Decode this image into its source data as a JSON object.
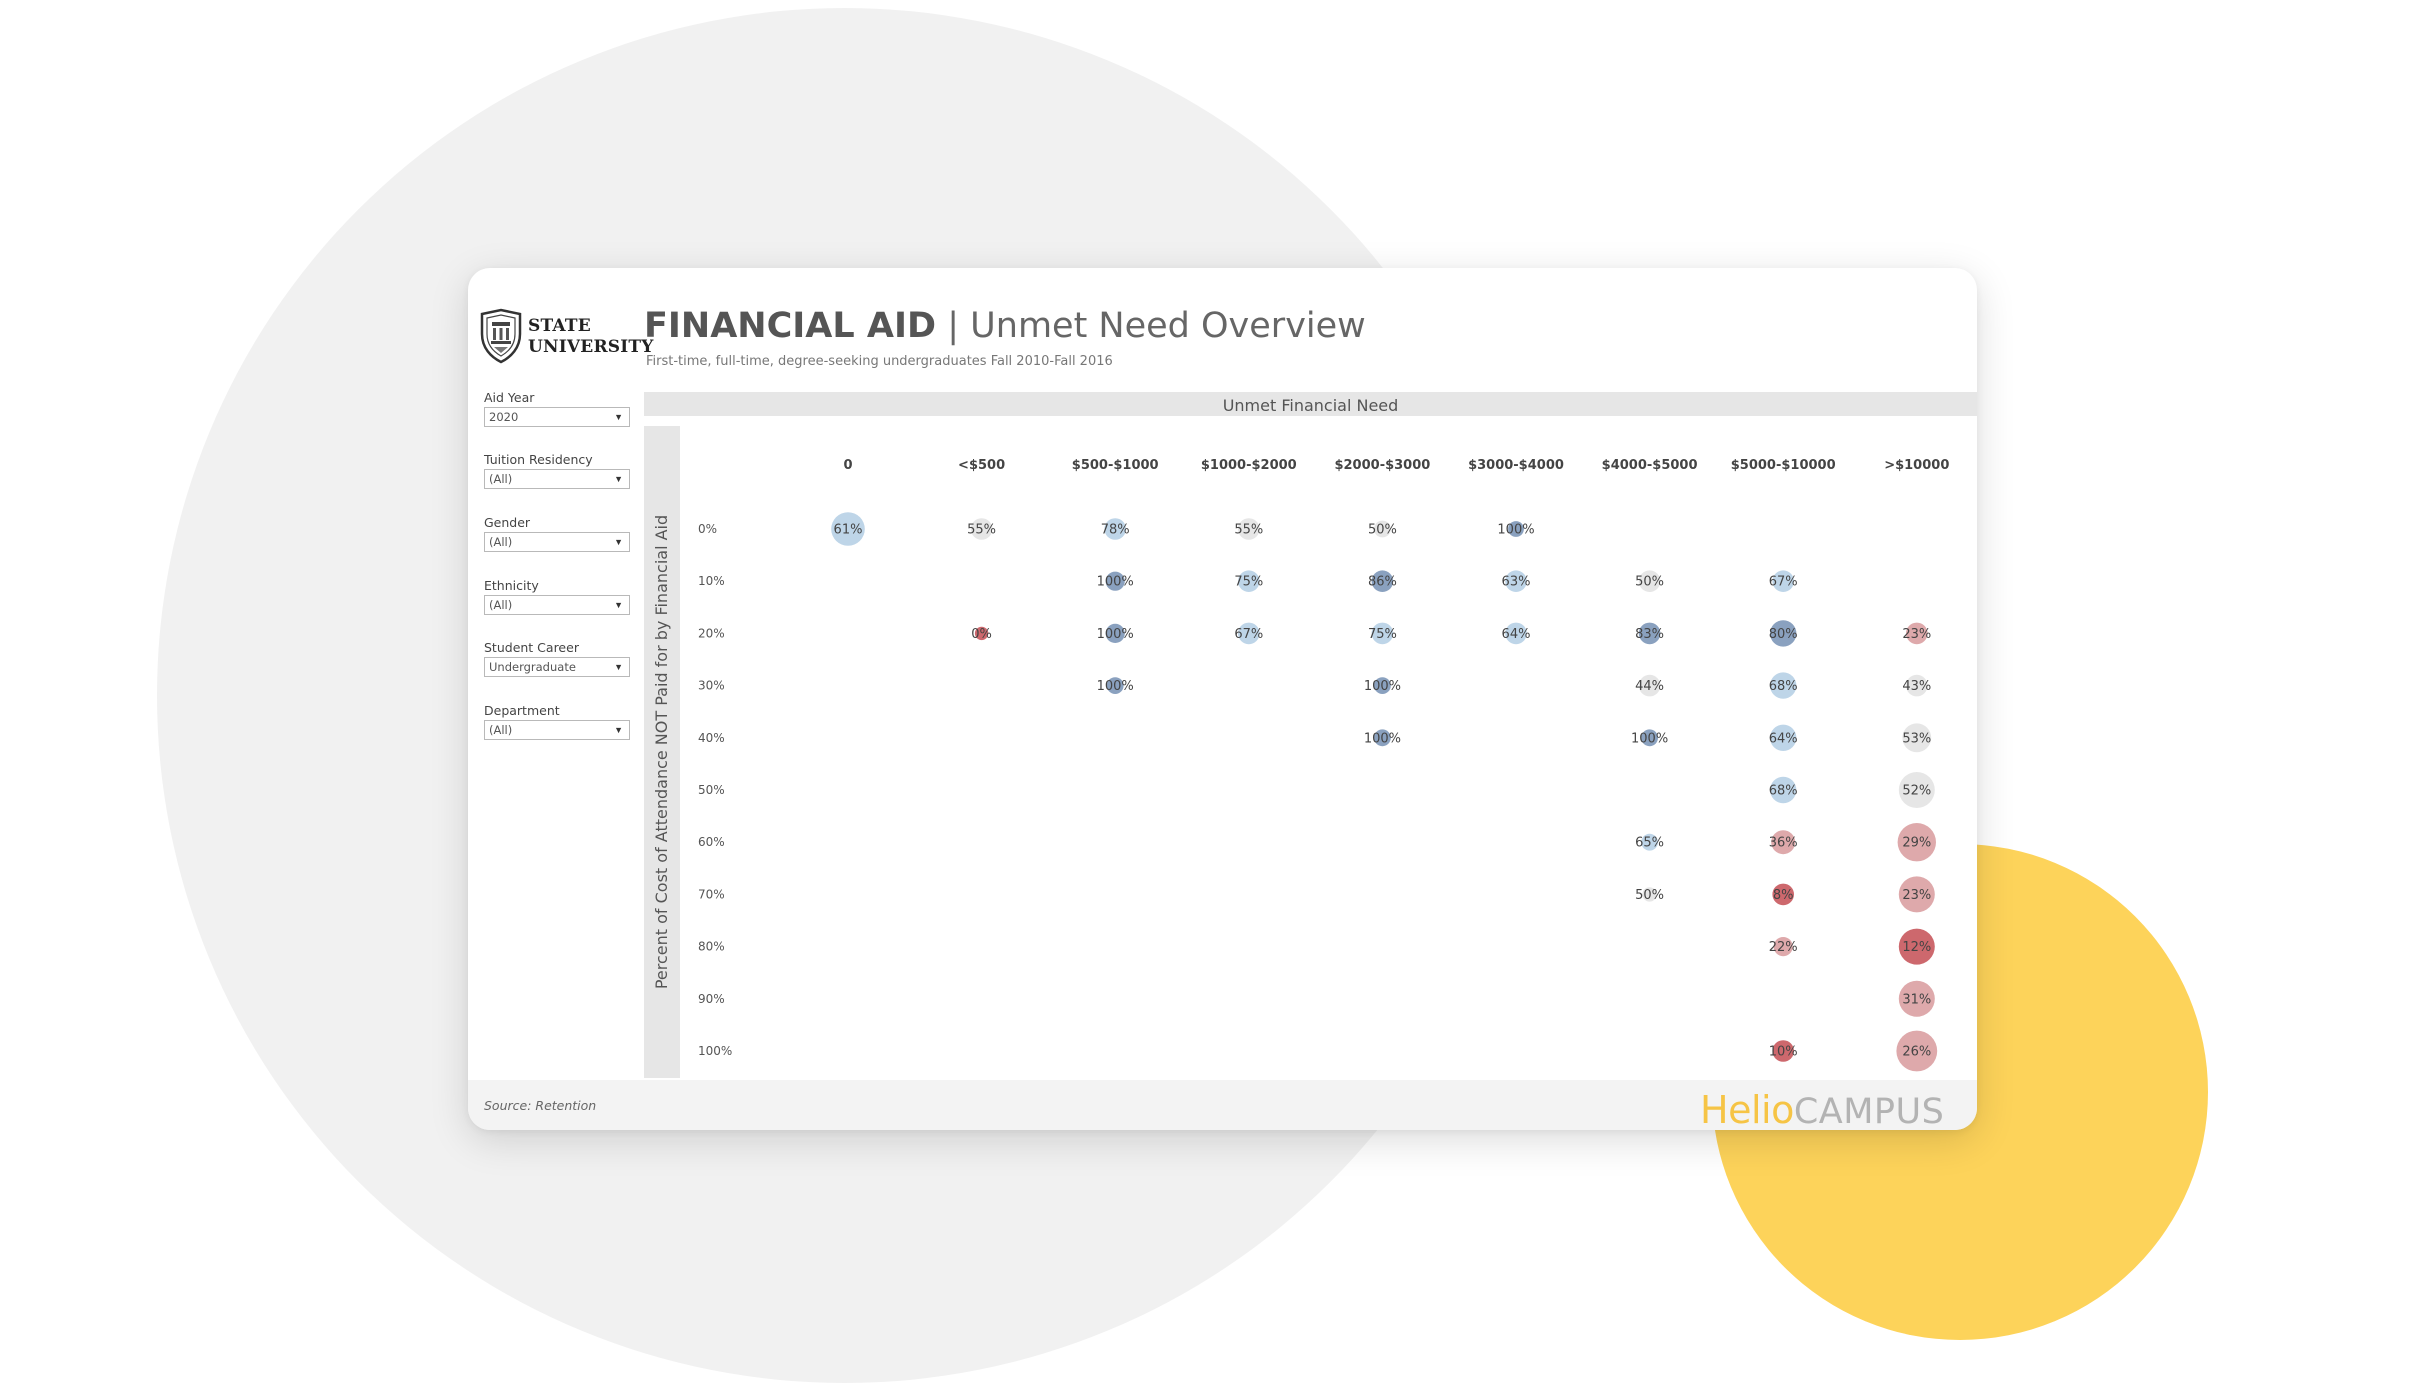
{
  "header": {
    "logo_text_line1": "STATE",
    "logo_text_line2": "UNIVERSITY",
    "title_main": "FINANCIAL AID",
    "title_separator": "|",
    "title_sub": "Unmet Need Overview",
    "subtitle": "First-time, full-time, degree-seeking undergraduates Fall 2010-Fall 2016"
  },
  "filters": [
    {
      "label": "Aid Year",
      "value": "2020"
    },
    {
      "label": "Tuition Residency",
      "value": "(All)"
    },
    {
      "label": "Gender",
      "value": "(All)"
    },
    {
      "label": "Ethnicity",
      "value": "(All)"
    },
    {
      "label": "Student Career",
      "value": "Undergraduate"
    },
    {
      "label": "Department",
      "value": "(All)"
    }
  ],
  "footer": {
    "source": "Source: Retention",
    "brand_part1": "Helio",
    "brand_part2": "CAMPUS"
  },
  "colors": {
    "blue_dark": "#7d97b8",
    "blue_mid": "#98b7d6",
    "blue_light": "#b7d0e6",
    "gray": "#e3e3e3",
    "red_light": "#daa0a2",
    "red_mid": "#d07c80",
    "red_dark": "#c8585d",
    "brand_yellow": "#f6c445"
  },
  "chart_data": {
    "type": "scatter",
    "title": "Unmet Financial Need",
    "xlabel": "Unmet Financial Need",
    "ylabel": "Percent of Cost of Attendance NOT Paid for by Financial Aid",
    "columns": [
      "0",
      "<$500",
      "$500-$1000",
      "$1000-$2000",
      "$2000-$3000",
      "$3000-$4000",
      "$4000-$5000",
      "$5000-$10000",
      ">$10000"
    ],
    "rows": [
      "0%",
      "10%",
      "20%",
      "30%",
      "40%",
      "50%",
      "60%",
      "70%",
      "80%",
      "90%",
      "100%"
    ],
    "points": [
      {
        "row": "0%",
        "col": "0",
        "label": "61%",
        "size": 0.7,
        "color": "blue_light"
      },
      {
        "row": "0%",
        "col": "<$500",
        "label": "55%",
        "size": 0.45,
        "color": "gray"
      },
      {
        "row": "0%",
        "col": "$500-$1000",
        "label": "78%",
        "size": 0.45,
        "color": "blue_light"
      },
      {
        "row": "0%",
        "col": "$1000-$2000",
        "label": "55%",
        "size": 0.45,
        "color": "gray"
      },
      {
        "row": "0%",
        "col": "$2000-$3000",
        "label": "50%",
        "size": 0.35,
        "color": "gray"
      },
      {
        "row": "0%",
        "col": "$3000-$4000",
        "label": "100%",
        "size": 0.33,
        "color": "blue_dark"
      },
      {
        "row": "10%",
        "col": "$500-$1000",
        "label": "100%",
        "size": 0.4,
        "color": "blue_dark"
      },
      {
        "row": "10%",
        "col": "$1000-$2000",
        "label": "75%",
        "size": 0.45,
        "color": "blue_light"
      },
      {
        "row": "10%",
        "col": "$2000-$3000",
        "label": "86%",
        "size": 0.45,
        "color": "blue_dark"
      },
      {
        "row": "10%",
        "col": "$3000-$4000",
        "label": "63%",
        "size": 0.45,
        "color": "blue_light"
      },
      {
        "row": "10%",
        "col": "$4000-$5000",
        "label": "50%",
        "size": 0.45,
        "color": "gray"
      },
      {
        "row": "10%",
        "col": "$5000-$10000",
        "label": "67%",
        "size": 0.45,
        "color": "blue_light"
      },
      {
        "row": "20%",
        "col": "<$500",
        "label": "0%",
        "size": 0.28,
        "color": "red_dark"
      },
      {
        "row": "20%",
        "col": "$500-$1000",
        "label": "100%",
        "size": 0.4,
        "color": "blue_dark"
      },
      {
        "row": "20%",
        "col": "$1000-$2000",
        "label": "67%",
        "size": 0.45,
        "color": "blue_light"
      },
      {
        "row": "20%",
        "col": "$2000-$3000",
        "label": "75%",
        "size": 0.45,
        "color": "blue_light"
      },
      {
        "row": "20%",
        "col": "$3000-$4000",
        "label": "64%",
        "size": 0.45,
        "color": "blue_light"
      },
      {
        "row": "20%",
        "col": "$4000-$5000",
        "label": "83%",
        "size": 0.45,
        "color": "blue_dark"
      },
      {
        "row": "20%",
        "col": "$5000-$10000",
        "label": "80%",
        "size": 0.55,
        "color": "blue_dark"
      },
      {
        "row": "20%",
        "col": ">$10000",
        "label": "23%",
        "size": 0.45,
        "color": "red_light"
      },
      {
        "row": "30%",
        "col": "$500-$1000",
        "label": "100%",
        "size": 0.35,
        "color": "blue_dark"
      },
      {
        "row": "30%",
        "col": "$2000-$3000",
        "label": "100%",
        "size": 0.35,
        "color": "blue_dark"
      },
      {
        "row": "30%",
        "col": "$4000-$5000",
        "label": "44%",
        "size": 0.45,
        "color": "gray"
      },
      {
        "row": "30%",
        "col": "$5000-$10000",
        "label": "68%",
        "size": 0.55,
        "color": "blue_light"
      },
      {
        "row": "30%",
        "col": ">$10000",
        "label": "43%",
        "size": 0.45,
        "color": "gray"
      },
      {
        "row": "40%",
        "col": "$2000-$3000",
        "label": "100%",
        "size": 0.35,
        "color": "blue_dark"
      },
      {
        "row": "40%",
        "col": "$4000-$5000",
        "label": "100%",
        "size": 0.35,
        "color": "blue_dark"
      },
      {
        "row": "40%",
        "col": "$5000-$10000",
        "label": "64%",
        "size": 0.55,
        "color": "blue_light"
      },
      {
        "row": "40%",
        "col": ">$10000",
        "label": "53%",
        "size": 0.6,
        "color": "gray"
      },
      {
        "row": "50%",
        "col": "$5000-$10000",
        "label": "68%",
        "size": 0.55,
        "color": "blue_light"
      },
      {
        "row": "50%",
        "col": ">$10000",
        "label": "52%",
        "size": 0.75,
        "color": "gray"
      },
      {
        "row": "60%",
        "col": "$4000-$5000",
        "label": "65%",
        "size": 0.35,
        "color": "blue_light"
      },
      {
        "row": "60%",
        "col": "$5000-$10000",
        "label": "36%",
        "size": 0.5,
        "color": "red_light"
      },
      {
        "row": "60%",
        "col": ">$10000",
        "label": "29%",
        "size": 0.8,
        "color": "red_light"
      },
      {
        "row": "70%",
        "col": "$4000-$5000",
        "label": "50%",
        "size": 0.3,
        "color": "gray"
      },
      {
        "row": "70%",
        "col": "$5000-$10000",
        "label": "8%",
        "size": 0.45,
        "color": "red_dark"
      },
      {
        "row": "70%",
        "col": ">$10000",
        "label": "23%",
        "size": 0.75,
        "color": "red_light"
      },
      {
        "row": "80%",
        "col": "$5000-$10000",
        "label": "22%",
        "size": 0.4,
        "color": "red_light"
      },
      {
        "row": "80%",
        "col": ">$10000",
        "label": "12%",
        "size": 0.75,
        "color": "red_dark"
      },
      {
        "row": "90%",
        "col": ">$10000",
        "label": "31%",
        "size": 0.75,
        "color": "red_light"
      },
      {
        "row": "100%",
        "col": "$5000-$10000",
        "label": "10%",
        "size": 0.45,
        "color": "red_dark"
      },
      {
        "row": "100%",
        "col": ">$10000",
        "label": "26%",
        "size": 0.85,
        "color": "red_light"
      }
    ]
  }
}
